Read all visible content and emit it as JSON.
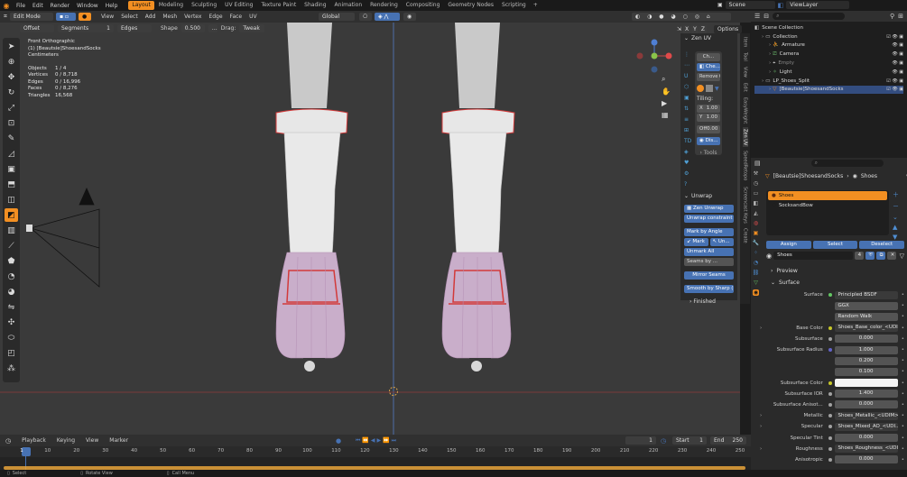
{
  "topbar": {
    "menus": [
      "File",
      "Edit",
      "Render",
      "Window",
      "Help"
    ],
    "workspaces": [
      "Layout",
      "Modeling",
      "Sculpting",
      "UV Editing",
      "Texture Paint",
      "Shading",
      "Animation",
      "Rendering",
      "Compositing",
      "Geometry Nodes",
      "Scripting"
    ],
    "active_workspace": "Layout",
    "plus_label": "+",
    "scene": "Scene",
    "view_layer": "ViewLayer"
  },
  "viewport_header": {
    "mode": "Edit Mode",
    "menus": [
      "View",
      "Select",
      "Add",
      "Mesh",
      "Vertex",
      "Edge",
      "Face",
      "UV"
    ],
    "orientation": "Global",
    "options_label": "Options",
    "axes": [
      "X",
      "Y",
      "Z"
    ]
  },
  "tool_settings": {
    "offset_label": "Offset",
    "segments_label": "Segments",
    "segments_value": "1",
    "edges_label": "Edges",
    "shape_label": "Shape",
    "shape_value": "0.500",
    "drag_label": "Drag:",
    "drag_value": "Tweak"
  },
  "overlay": {
    "view_name": "Front Orthographic",
    "object_name": "(1) [Beautsie]ShoesandSocks",
    "units": "Centimeters",
    "stats": [
      {
        "label": "Objects",
        "value": "1 / 4"
      },
      {
        "label": "Vertices",
        "value": "0 / 8,718"
      },
      {
        "label": "Edges",
        "value": "0 / 16,996"
      },
      {
        "label": "Faces",
        "value": "0 / 8,276"
      },
      {
        "label": "Triangles",
        "value": "16,568"
      }
    ]
  },
  "zen_uv": {
    "title": "Zen UV",
    "ch_label": "Ch...",
    "che_label": "Che...",
    "remove_label": "Remove C...",
    "tiling_label": "Tiling:",
    "tiling_x_label": "X",
    "tiling_x": "1.00",
    "tiling_y_label": "Y",
    "tiling_y": "1.00",
    "off_label": "Off",
    "off_value": "0.00",
    "dis_label": "Dis...",
    "tools_label": "Tools",
    "unwrap_section": "Unwrap",
    "unwrap_buttons": [
      "Zen Unwrap",
      "Unwrap constraint",
      "Mark by Angle"
    ],
    "mark_label": "Mark",
    "un_label": "Un...",
    "unmark_all": "Unmark All",
    "seams_by": "Seams by ...",
    "mirror_seams": "Mirror Seams",
    "smooth_by_sharp": "Smooth by Sharp (...",
    "finished": "Finished"
  },
  "side_tabs": [
    "Item",
    "Tool",
    "View",
    "Edit",
    "EasyWeight",
    "Zen UV",
    "SpeedRetopo",
    "Screencast Keys",
    "Create"
  ],
  "outliner": {
    "rows": [
      {
        "label": "Scene Collection",
        "indent": 0
      },
      {
        "label": "Collection",
        "indent": 1
      },
      {
        "label": "Armature",
        "indent": 2
      },
      {
        "label": "Camera",
        "indent": 2
      },
      {
        "label": "Empty",
        "indent": 2
      },
      {
        "label": "Light",
        "indent": 2
      },
      {
        "label": "LP_Shoes_Split",
        "indent": 1
      },
      {
        "label": "[Beautsie]ShoesandSocks",
        "indent": 2,
        "selected": true
      }
    ]
  },
  "properties": {
    "breadcrumb_object": "[Beautsie]ShoesandSocks",
    "breadcrumb_material": "Shoes",
    "material_slots": [
      "Shoes",
      "SocksandBow"
    ],
    "assign": "Assign",
    "select": "Select",
    "deselect": "Deselect",
    "material_name": "Shoes",
    "material_users": "4",
    "preview_section": "Preview",
    "surface_section": "Surface",
    "fields": [
      {
        "label": "Surface",
        "value": "Principled BSDF",
        "kind": "link",
        "dot": "#63c763"
      },
      {
        "label": "",
        "value": "GGX",
        "kind": "menu"
      },
      {
        "label": "",
        "value": "Random Walk",
        "kind": "menu"
      },
      {
        "label": "Base Color",
        "value": "Shoes_Base_color_<UDI...",
        "kind": "link",
        "dot": "#c7c729"
      },
      {
        "label": "Subsurface",
        "value": "0.000",
        "kind": "num",
        "dot": "#a1a1a1"
      },
      {
        "label": "Subsurface Radius",
        "value": "1.000",
        "kind": "num",
        "dot": "#6363c7"
      },
      {
        "label": "",
        "value": "0.200",
        "kind": "num"
      },
      {
        "label": "",
        "value": "0.100",
        "kind": "num"
      },
      {
        "label": "Subsurface Color",
        "value": "",
        "kind": "color",
        "dot": "#c7c729"
      },
      {
        "label": "Subsurface IOR",
        "value": "1.400",
        "kind": "num",
        "dot": "#a1a1a1"
      },
      {
        "label": "Subsurface Anisot...",
        "value": "0.000",
        "kind": "num",
        "dot": "#a1a1a1"
      },
      {
        "label": "Metallic",
        "value": "Shoes_Metallic_<UDIM>...",
        "kind": "link",
        "dot": "#a1a1a1"
      },
      {
        "label": "Specular",
        "value": "Shoes_Mixed_AO_<UDI...",
        "kind": "link",
        "dot": "#a1a1a1"
      },
      {
        "label": "Specular Tint",
        "value": "0.000",
        "kind": "num",
        "dot": "#a1a1a1"
      },
      {
        "label": "Roughness",
        "value": "Shoes_Roughness_<UDI...",
        "kind": "link",
        "dot": "#a1a1a1"
      },
      {
        "label": "Anisotropic",
        "value": "0.000",
        "kind": "num",
        "dot": "#a1a1a1"
      }
    ]
  },
  "timeline": {
    "menus": [
      "Playback",
      "Keying",
      "View",
      "Marker"
    ],
    "current_frame": "1",
    "start_label": "Start",
    "start": "1",
    "end_label": "End",
    "end": "250",
    "ticks": [
      {
        "label": "1",
        "frame": 1
      },
      {
        "label": "10",
        "frame": 10
      },
      {
        "label": "20",
        "frame": 20
      },
      {
        "label": "30",
        "frame": 30
      },
      {
        "label": "40",
        "frame": 40
      },
      {
        "label": "50",
        "frame": 50
      },
      {
        "label": "60",
        "frame": 60
      },
      {
        "label": "70",
        "frame": 70
      },
      {
        "label": "80",
        "frame": 80
      },
      {
        "label": "90",
        "frame": 90
      },
      {
        "label": "100",
        "frame": 100
      },
      {
        "label": "110",
        "frame": 110
      },
      {
        "label": "120",
        "frame": 120
      },
      {
        "label": "130",
        "frame": 130
      },
      {
        "label": "140",
        "frame": 140
      },
      {
        "label": "150",
        "frame": 150
      },
      {
        "label": "160",
        "frame": 160
      },
      {
        "label": "170",
        "frame": 170
      },
      {
        "label": "180",
        "frame": 180
      },
      {
        "label": "190",
        "frame": 190
      },
      {
        "label": "200",
        "frame": 200
      },
      {
        "label": "210",
        "frame": 210
      },
      {
        "label": "220",
        "frame": 220
      },
      {
        "label": "230",
        "frame": 230
      },
      {
        "label": "240",
        "frame": 240
      },
      {
        "label": "250",
        "frame": 250
      }
    ]
  },
  "statusbar": {
    "items": [
      "Select",
      "Rotate View",
      "Call Menu"
    ]
  },
  "colors": {
    "accent": "#f28f22",
    "blue": "#4772b3",
    "sock": "#c8c8c8",
    "shoe": "#c9aeca",
    "strap": "#d23a3a"
  }
}
